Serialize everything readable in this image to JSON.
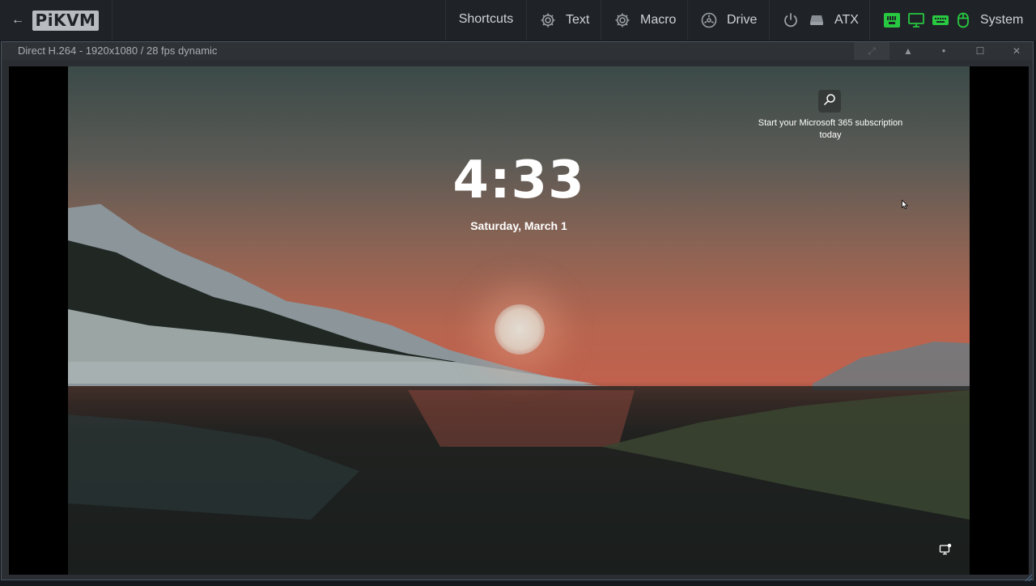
{
  "navbar": {
    "back_label": "←",
    "logo_text": "PiKVM",
    "shortcuts_label": "Shortcuts",
    "text_label": "Text",
    "macro_label": "Macro",
    "drive_label": "Drive",
    "atx_label": "ATX",
    "system_label": "System",
    "icons": {
      "text": "gear-icon",
      "macro": "gear-icon",
      "drive": "drive-icon",
      "atx": "power-icon",
      "atx_extra": "hdd-icon",
      "status": [
        "network-icon",
        "monitor-icon",
        "keyboard-icon",
        "mouse-icon"
      ]
    },
    "status_color": "#28c840"
  },
  "stream_window": {
    "title": "Direct H.264 - 1920x1080 / 28 fps dynamic",
    "buttons": [
      "full-tab",
      "screenshot",
      "dot",
      "maximize",
      "close"
    ],
    "maximize_symbol": "☐",
    "close_symbol": "✕",
    "screenshot_symbol": "▲",
    "dot_symbol": "●",
    "full_tab_symbol": "⤢"
  },
  "lock_screen": {
    "time": "4:33",
    "date": "Saturday, March 1",
    "promo_text": "Start your Microsoft 365 subscription today"
  }
}
